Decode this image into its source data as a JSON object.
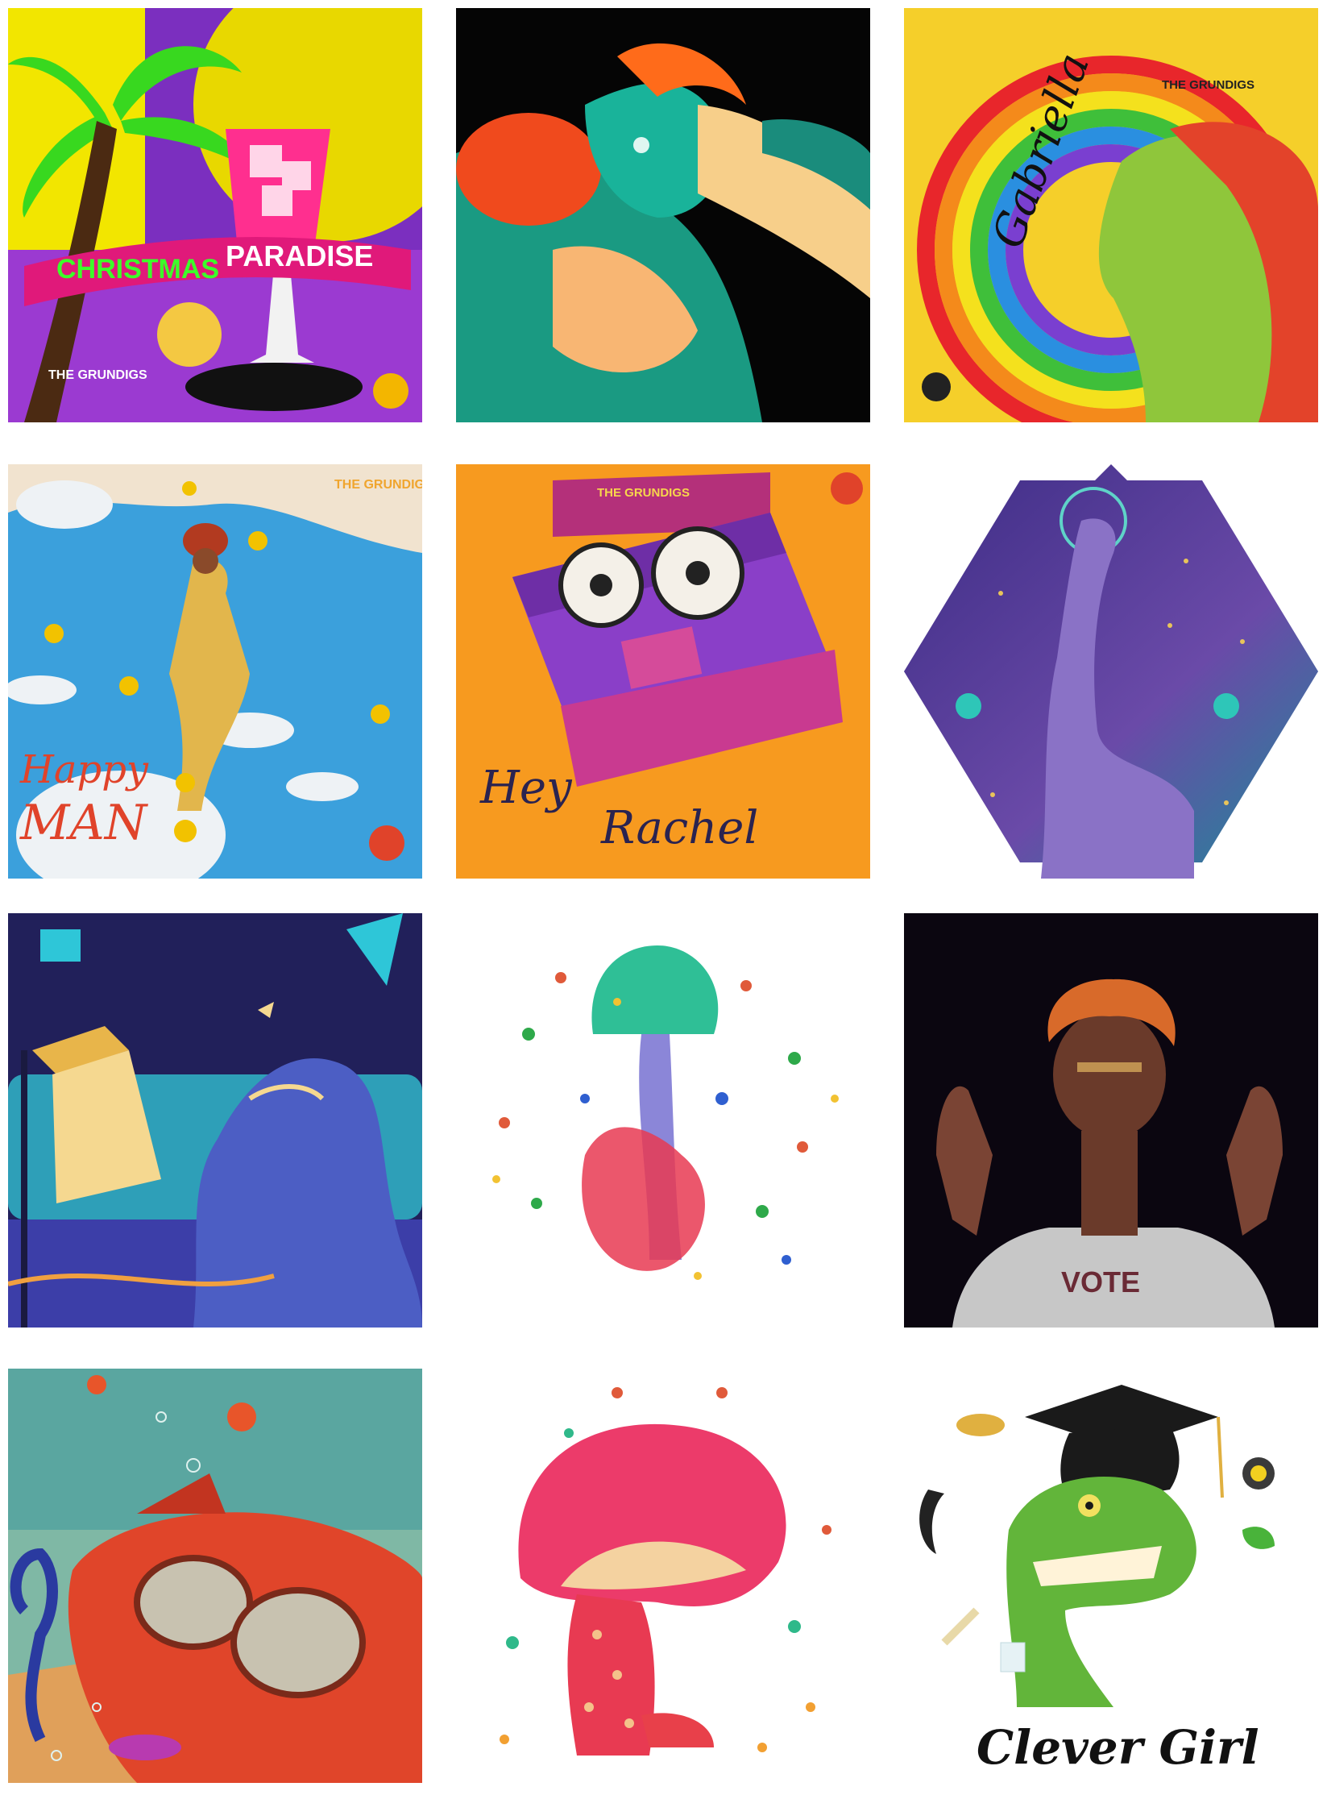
{
  "tiles": [
    {
      "id": "christmas-paradise",
      "title_left": "CHRISTMAS",
      "title_right": "PARADISE",
      "band": "THE GRUNDIGS"
    },
    {
      "id": "eyes-art"
    },
    {
      "id": "gabriella",
      "title": "Gabriella",
      "band": "THE GRUNDIGS"
    },
    {
      "id": "happy-man",
      "title_line1": "Happy",
      "title_line2": "MAN",
      "band": "THE GRUNDIGS"
    },
    {
      "id": "hey-rachel",
      "title_line1": "Hey",
      "title_line2": "Rachel",
      "band": "THE GRUNDIGS"
    },
    {
      "id": "dino-astronaut"
    },
    {
      "id": "lamp-wave"
    },
    {
      "id": "teal-mushroom"
    },
    {
      "id": "vote-man",
      "shirt_text": "VOTE"
    },
    {
      "id": "submarine"
    },
    {
      "id": "red-mushroom"
    },
    {
      "id": "clever-girl",
      "title": "Clever Girl"
    }
  ],
  "colors": {
    "background": "#ffffff"
  }
}
